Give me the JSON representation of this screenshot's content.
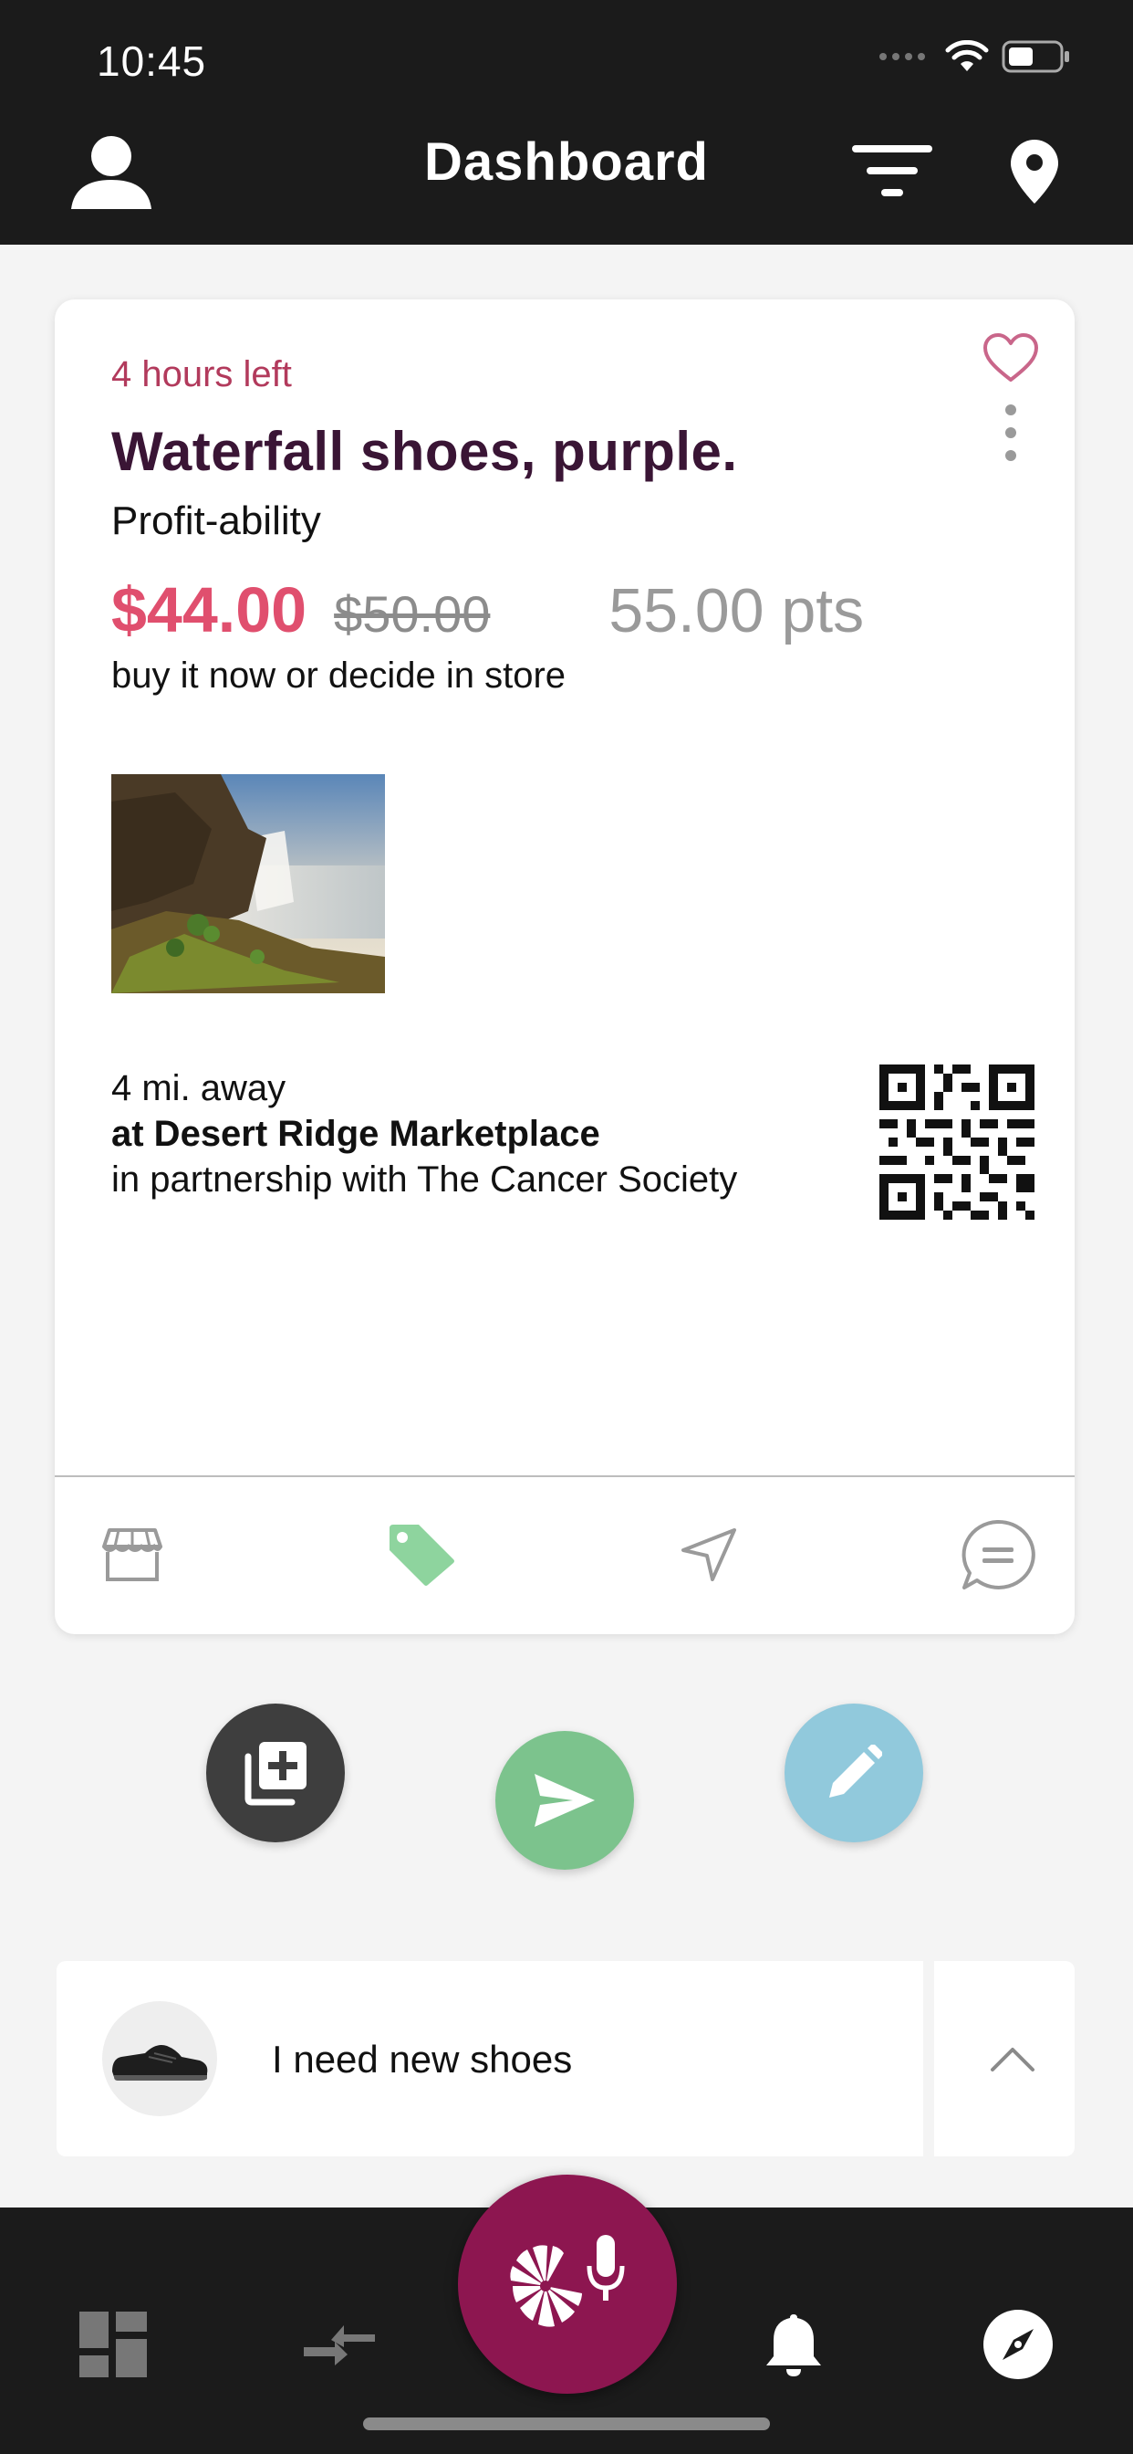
{
  "status_bar": {
    "time": "10:45"
  },
  "header": {
    "title": "Dashboard",
    "icons": [
      "user-icon",
      "filter-icon",
      "location-pin-icon"
    ]
  },
  "offer": {
    "time_left": "4 hours left",
    "title": "Waterfall shoes, purple.",
    "merchant": "Profit-ability",
    "price": "$44.00",
    "original_price": "$50.00",
    "points": "55.00 pts",
    "purchase_hint": "buy it now or decide in store",
    "distance": "4 mi. away",
    "location": "at Desert Ridge Marketplace",
    "partner": "in partnership with The Cancer Society",
    "favorite": false,
    "actions": [
      "store-icon",
      "tag-icon",
      "send-location-icon",
      "chat-icon"
    ],
    "active_action": "tag-icon"
  },
  "fabs": [
    "add-to-collection-icon",
    "send-icon",
    "edit-icon"
  ],
  "need": {
    "text": "I need new shoes"
  },
  "tabbar": {
    "items": [
      "dashboard-icon",
      "swap-icon",
      "voice-assistant-icon",
      "bell-icon",
      "compass-icon"
    ]
  },
  "colors": {
    "header_bg": "#1b1b1b",
    "accent_pink": "#e04f6e",
    "title_plum": "#3a1535",
    "tag_green": "#8ed49e",
    "fab_dark": "#3e3e3e",
    "fab_green": "#7cc38d",
    "fab_blue": "#91c9dc",
    "voice_magenta": "#8d1650"
  }
}
